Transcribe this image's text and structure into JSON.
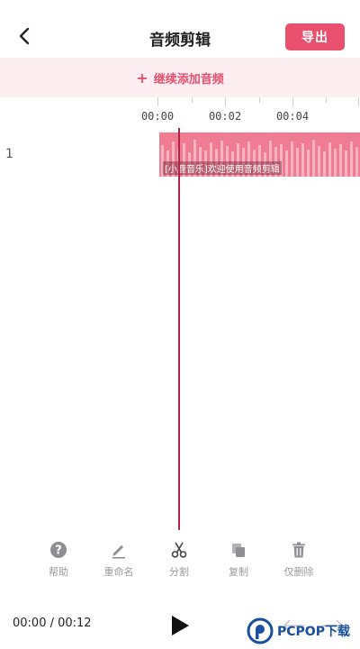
{
  "header": {
    "title": "音频剪辑",
    "export_label": "导出"
  },
  "add_audio": {
    "label": "继续添加音频"
  },
  "ruler": {
    "ticks": [
      "00:00",
      "00:02",
      "00:04"
    ]
  },
  "track": {
    "number": "1",
    "clip_label": "[小鹿音乐]欢迎使用音频剪辑"
  },
  "toolbar": {
    "items": [
      {
        "label": "帮助",
        "icon": "help-icon"
      },
      {
        "label": "重命名",
        "icon": "pencil-icon"
      },
      {
        "label": "分割",
        "icon": "scissors-icon"
      },
      {
        "label": "复制",
        "icon": "copy-icon"
      },
      {
        "label": "仅删除",
        "icon": "trash-icon"
      }
    ]
  },
  "playback": {
    "current_time": "00:00",
    "total_time": "00:12",
    "time_display": "00:00 / 00:12"
  },
  "watermark": {
    "text": "PCPOP下载"
  },
  "colors": {
    "accent": "#e8506d",
    "clip": "#f07c93",
    "playhead": "#b0244a",
    "add_bar_bg": "#fdeef2"
  }
}
